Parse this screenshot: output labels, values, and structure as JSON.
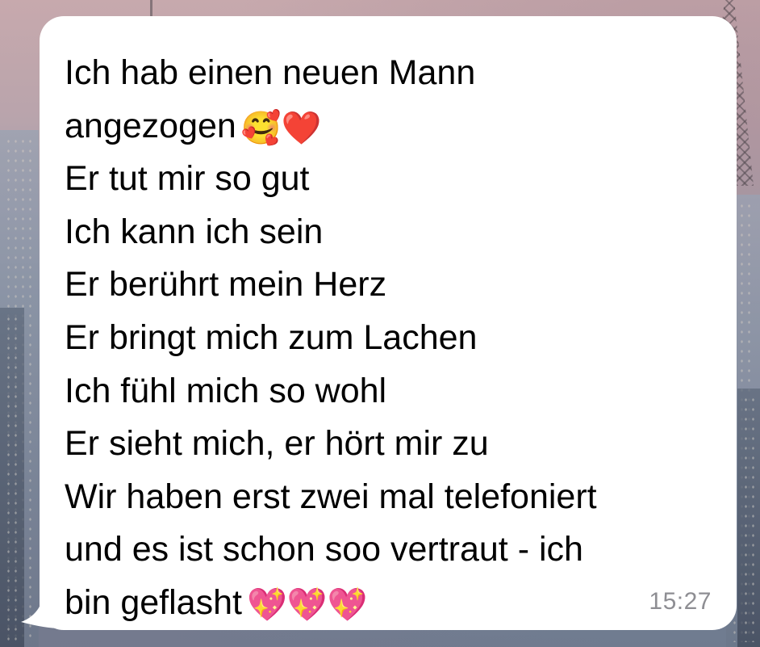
{
  "message": {
    "lines": [
      "Ich hab einen neuen Mann",
      "angezogen",
      "Er tut mir so gut",
      "Ich kann ich sein",
      "Er berührt mein Herz",
      "Er bringt mich zum Lachen",
      "Ich fühl mich so wohl",
      "Er sieht mich, er hört mir zu",
      "Wir haben erst zwei mal telefoniert",
      "und es ist schon soo vertraut - ich",
      "bin geflasht"
    ],
    "emoji_line_2": "🥰❤️",
    "emoji_line_11": "💖💖💖",
    "timestamp": "15:27"
  },
  "colors": {
    "bubble": "#ffffff",
    "text": "#000000",
    "timestamp": "#8e8e93"
  }
}
